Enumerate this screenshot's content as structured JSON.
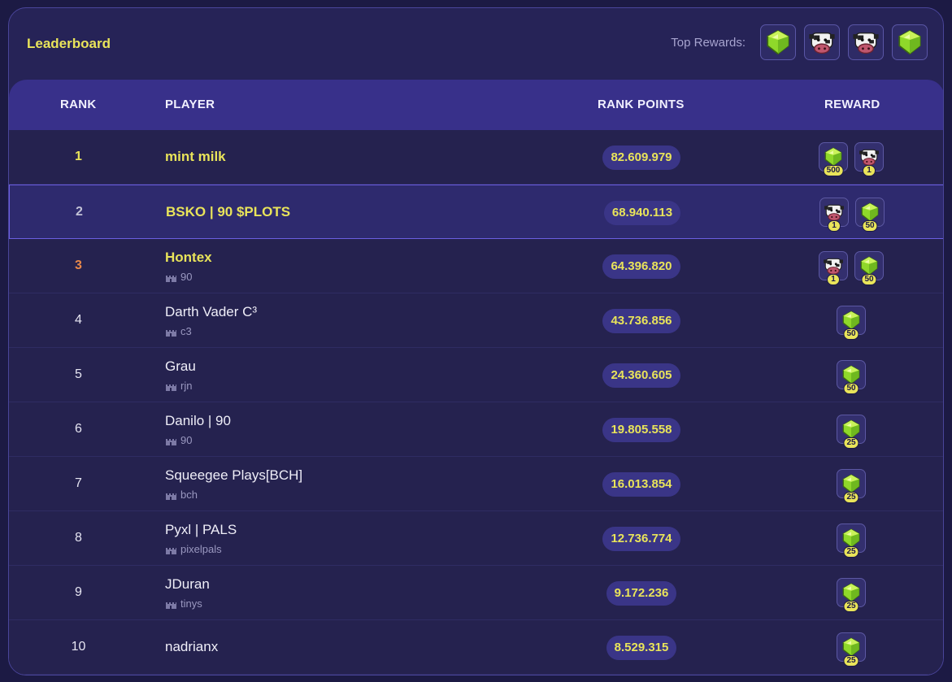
{
  "leaderboard": {
    "title": "Leaderboard",
    "top_rewards_label": "Top Rewards:",
    "top_rewards": [
      "gem-icon",
      "cow-icon",
      "cow-icon",
      "gem-icon"
    ]
  },
  "table": {
    "columns": [
      "RANK",
      "PLAYER",
      "RANK POINTS",
      "REWARD"
    ],
    "rows": [
      {
        "rank": "1",
        "player": "mint milk",
        "guild": "",
        "points": "82.609.979",
        "rewards": [
          {
            "icon": "gem-icon",
            "qty": "500"
          },
          {
            "icon": "cow-icon",
            "qty": "1"
          }
        ]
      },
      {
        "rank": "2",
        "player": "BSKO | 90 $PLOTS",
        "guild": "",
        "points": "68.940.113",
        "rewards": [
          {
            "icon": "cow-icon",
            "qty": "1"
          },
          {
            "icon": "gem-icon",
            "qty": "50"
          }
        ]
      },
      {
        "rank": "3",
        "player": "Hontex",
        "guild": "90",
        "points": "64.396.820",
        "rewards": [
          {
            "icon": "cow-icon",
            "qty": "1"
          },
          {
            "icon": "gem-icon",
            "qty": "50"
          }
        ]
      },
      {
        "rank": "4",
        "player": "Darth Vader C³",
        "guild": "c3",
        "points": "43.736.856",
        "rewards": [
          {
            "icon": "gem-icon",
            "qty": "50"
          }
        ]
      },
      {
        "rank": "5",
        "player": "Grau",
        "guild": "rjn",
        "points": "24.360.605",
        "rewards": [
          {
            "icon": "gem-icon",
            "qty": "50"
          }
        ]
      },
      {
        "rank": "6",
        "player": "Danilo | 90",
        "guild": "90",
        "points": "19.805.558",
        "rewards": [
          {
            "icon": "gem-icon",
            "qty": "25"
          }
        ]
      },
      {
        "rank": "7",
        "player": "Squeegee Plays[BCH]",
        "guild": "bch",
        "points": "16.013.854",
        "rewards": [
          {
            "icon": "gem-icon",
            "qty": "25"
          }
        ]
      },
      {
        "rank": "8",
        "player": "Pyxl | PALS",
        "guild": "pixelpals",
        "points": "12.736.774",
        "rewards": [
          {
            "icon": "gem-icon",
            "qty": "25"
          }
        ]
      },
      {
        "rank": "9",
        "player": "JDuran",
        "guild": "tinys",
        "points": "9.172.236",
        "rewards": [
          {
            "icon": "gem-icon",
            "qty": "25"
          }
        ]
      },
      {
        "rank": "10",
        "player": "nadrianx",
        "guild": "",
        "points": "8.529.315",
        "rewards": [
          {
            "icon": "gem-icon",
            "qty": "25"
          }
        ]
      }
    ]
  },
  "colors": {
    "accent_yellow": "#e9e45a",
    "background": "#1c1a44",
    "panel": "#262357",
    "header": "#38308a",
    "rank_3": "#e8884a"
  }
}
